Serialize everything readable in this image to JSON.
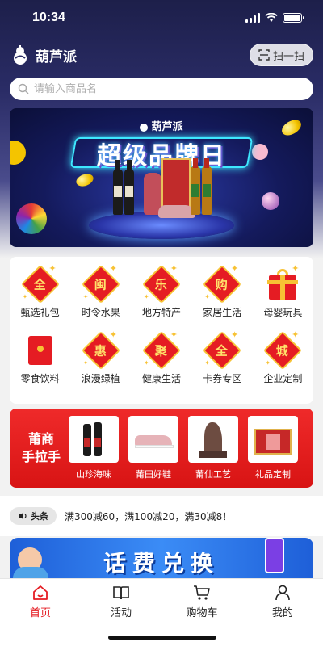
{
  "status_bar": {
    "time": "10:34"
  },
  "header": {
    "brand_name": "葫芦派",
    "scan_label": "扫一扫"
  },
  "search": {
    "placeholder": "请输入商品名"
  },
  "banner": {
    "logo_text": "葫芦派",
    "title": "超级品牌日"
  },
  "categories": [
    {
      "label": "甄选礼包",
      "icon": "quan-diamond-icon",
      "glyph": "全"
    },
    {
      "label": "时令水果",
      "icon": "min-diamond-icon",
      "glyph": "闽"
    },
    {
      "label": "地方特产",
      "icon": "le-diamond-icon",
      "glyph": "乐"
    },
    {
      "label": "家居生活",
      "icon": "gou-diamond-icon",
      "glyph": "购"
    },
    {
      "label": "母婴玩具",
      "icon": "gift-box-icon",
      "glyph": ""
    },
    {
      "label": "零食饮料",
      "icon": "red-envelope-icon",
      "glyph": ""
    },
    {
      "label": "浪漫绿植",
      "icon": "hui-diamond-icon",
      "glyph": "惠"
    },
    {
      "label": "健康生活",
      "icon": "ju-diamond-icon",
      "glyph": "聚"
    },
    {
      "label": "卡券专区",
      "icon": "quan-diamond-icon",
      "glyph": "全"
    },
    {
      "label": "企业定制",
      "icon": "cheng-diamond-icon",
      "glyph": "城"
    }
  ],
  "promo": {
    "title_line1": "莆商",
    "title_line2": "手拉手",
    "items": [
      {
        "label": "山珍海味",
        "icon": "wine-bottles-icon"
      },
      {
        "label": "莆田好鞋",
        "icon": "sneaker-icon"
      },
      {
        "label": "莆仙工艺",
        "icon": "root-carving-icon"
      },
      {
        "label": "礼品定制",
        "icon": "gift-set-icon"
      }
    ]
  },
  "ticker": {
    "tag": "头条",
    "text": "满300减60，满100减20，满30减8！"
  },
  "phone_banner": {
    "title": "话费兑换"
  },
  "tabbar": [
    {
      "label": "首页",
      "icon": "home-icon",
      "active": true
    },
    {
      "label": "活动",
      "icon": "book-icon",
      "active": false
    },
    {
      "label": "购物车",
      "icon": "cart-icon",
      "active": false
    },
    {
      "label": "我的",
      "icon": "user-icon",
      "active": false
    }
  ],
  "colors": {
    "accent": "#e51c23",
    "gold": "#f7c234",
    "header_bg": "#1d1f4a"
  }
}
